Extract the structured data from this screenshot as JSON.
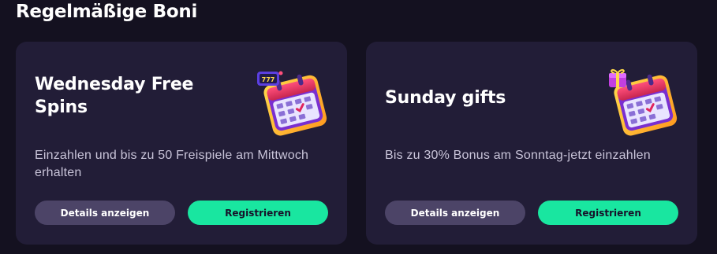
{
  "section": {
    "title": "Regelmäßige Boni"
  },
  "cards": [
    {
      "title": "Wednesday Free Spins",
      "description": "Einzahlen und bis zu 50 Freispiele am Mittwoch erhalten",
      "details_label": "Details anzeigen",
      "register_label": "Registrieren",
      "icon": "calendar-slot-icon"
    },
    {
      "title": "Sunday gifts",
      "description": "Bis zu 30% Bonus am Sonntag-jetzt einzahlen",
      "details_label": "Details anzeigen",
      "register_label": "Registrieren",
      "icon": "calendar-gift-icon"
    }
  ],
  "colors": {
    "background": "#141120",
    "card": "#221d37",
    "details_button": "#4c4467",
    "register_button": "#19e6a0"
  }
}
